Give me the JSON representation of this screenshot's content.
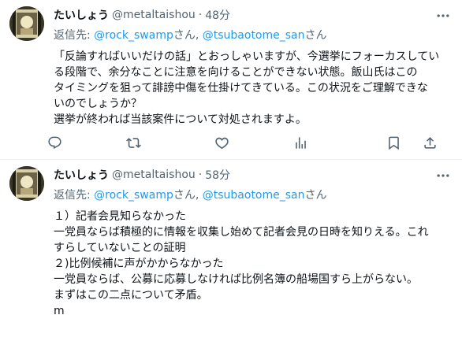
{
  "tweets": [
    {
      "author": {
        "display_name": "たいしょう",
        "handle": "@metaltaishou"
      },
      "dot": "·",
      "time": "48分",
      "reply": {
        "prefix": "返信先: ",
        "mention1": "@rock_swamp",
        "sep": "さん, ",
        "mention2": "@tsubaotome_san",
        "suffix": "さん"
      },
      "lines": [
        "「反論すればいいだけの話」とおっしゃいますが、今選挙にフォーカスしてい",
        "る段階で、余分なことに注意を向けることができない状態。飯山氏はこの",
        "タイミングを狙って誹謗中傷を仕掛けてきている。この状況をご理解できな",
        "いのでしょうか？",
        "選挙が終われば当該案件について対処されますよ。"
      ],
      "icons": {
        "more": "more-dots-icon",
        "reply": "reply-icon",
        "retweet": "retweet-icon",
        "like": "heart-icon",
        "views": "views-icon",
        "bookmark": "bookmark-icon",
        "share": "share-icon"
      }
    },
    {
      "author": {
        "display_name": "たいしょう",
        "handle": "@metaltaishou"
      },
      "dot": "·",
      "time": "58分",
      "reply": {
        "prefix": "返信先: ",
        "mention1": "@rock_swamp",
        "sep": "さん, ",
        "mention2": "@tsubaotome_san",
        "suffix": "さん"
      },
      "lines": [
        "１）記者会見知らなかった",
        "一党員ならば積極的に情報を収集し始めて記者会見の日時を知りえる。これ",
        "すらしていないことの証明",
        "２)比例候補に声がかからなかった",
        "一党員ならば、公募に応募しなければ比例名簿の船場国すら上がらない。",
        "まずはこの二点について矛盾。",
        "m"
      ],
      "icons": {
        "more": "more-dots-icon",
        "reply": "reply-icon",
        "retweet": "retweet-icon",
        "like": "heart-icon",
        "views": "views-icon",
        "bookmark": "bookmark-icon",
        "share": "share-icon"
      }
    }
  ],
  "colors": {
    "text": "#0f1419",
    "secondary": "#536471",
    "link": "#1d9bf0",
    "divider": "#eff3f4"
  }
}
